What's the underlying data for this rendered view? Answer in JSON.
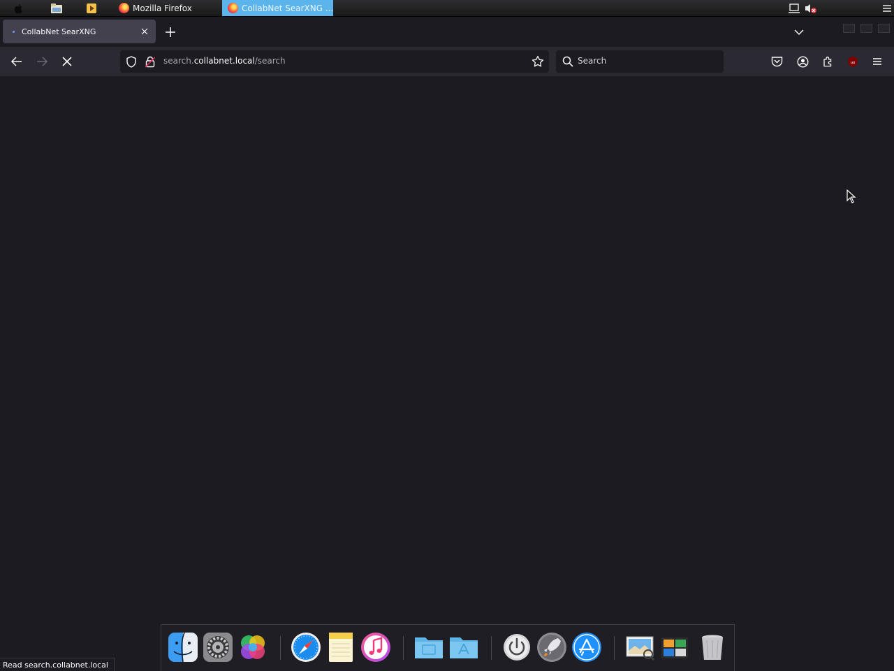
{
  "taskbar": {
    "tasks": [
      {
        "label": "Mozilla Firefox"
      },
      {
        "label": "CollabNet SearXNG ..."
      }
    ],
    "launchers": [
      "apple-icon",
      "file-manager-icon",
      "media-player-icon"
    ],
    "tray": [
      "network-icon",
      "volume-muted-icon",
      "menu-icon"
    ],
    "active_task_color": "#5bb4ec"
  },
  "browser": {
    "tab": {
      "title": "CollabNet SearXNG"
    },
    "url": {
      "prefix": "search.",
      "domain": "collabnet.local",
      "path": "/search"
    },
    "search": {
      "placeholder": "Search"
    },
    "toolbar_icons": [
      "pocket-icon",
      "account-icon",
      "extensions-icon",
      "ublock-origin-icon",
      "menu-icon"
    ],
    "status_text": "Read search.collabnet.local",
    "theme": {
      "background": "#1c1b22",
      "toolbar": "#2b2a33",
      "active_tab": "#42414d"
    }
  },
  "dock": {
    "items": [
      "finder-icon",
      "system-preferences-icon",
      "color-picker-icon",
      "safari-icon",
      "notes-icon",
      "music-icon",
      "folder-icon",
      "applications-folder-icon",
      "power-icon",
      "launchpad-icon",
      "app-store-icon",
      "preview-icon",
      "photo-viewer-icon",
      "trash-icon"
    ]
  }
}
